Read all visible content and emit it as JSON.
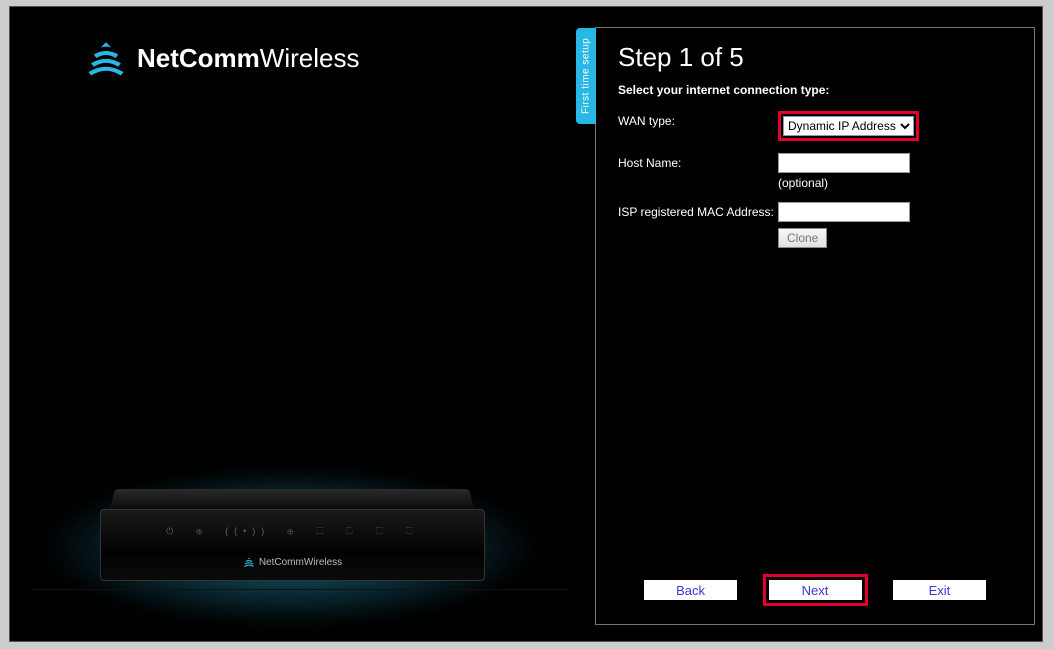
{
  "brand": {
    "bold": "NetComm",
    "light": "Wireless",
    "device_label": "NetCommWireless"
  },
  "tab": {
    "label": "First time setup"
  },
  "step": {
    "title": "Step 1 of 5",
    "subtitle": "Select your internet connection type:"
  },
  "form": {
    "wan_type_label": "WAN type:",
    "wan_type_value": "Dynamic IP Address",
    "host_name_label": "Host Name:",
    "host_name_value": "",
    "host_name_hint": "(optional)",
    "mac_label": "ISP registered MAC Address:",
    "mac_value": "",
    "clone_label": "Clone"
  },
  "buttons": {
    "back": "Back",
    "next": "Next",
    "exit": "Exit"
  },
  "colors": {
    "accent": "#29b8e5",
    "highlight": "#e4002b"
  }
}
